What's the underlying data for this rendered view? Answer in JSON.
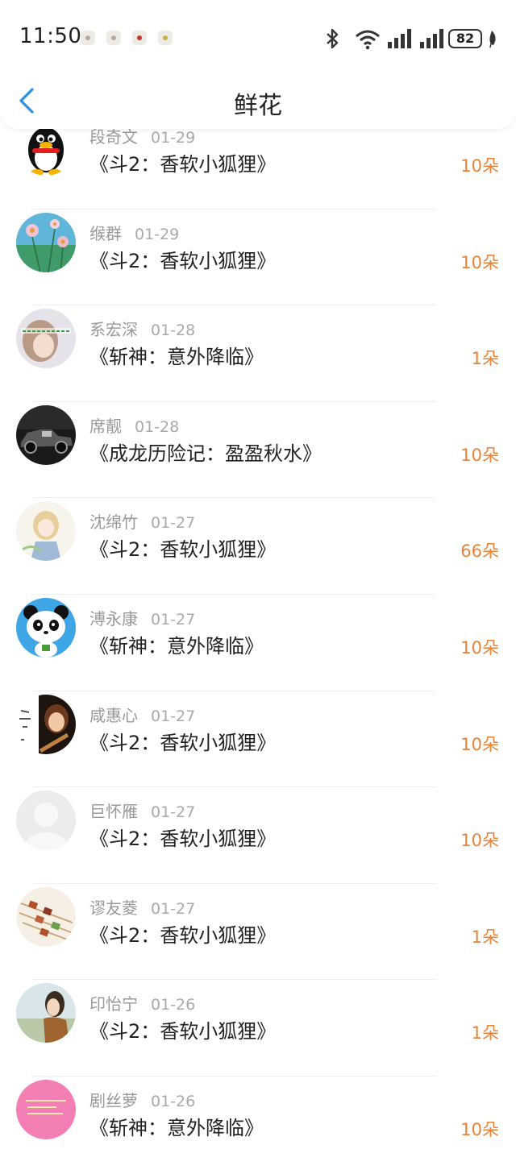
{
  "status_bar": {
    "time": "11:50",
    "battery": "82",
    "icons": [
      "notification-icon",
      "notification-icon",
      "notification-icon",
      "notification-icon",
      "bluetooth-icon",
      "wifi-icon",
      "signal-icon",
      "signal-icon",
      "battery-icon",
      "leaf-icon"
    ]
  },
  "nav": {
    "title": "鲜花",
    "back_icon": "chevron-left-icon"
  },
  "colors": {
    "accent": "#2b8fe6",
    "amount": "#e8833a",
    "meta": "#999999"
  },
  "flowers": [
    {
      "name": "段奇文",
      "date": "01-29",
      "work": "《斗2：香软小狐狸》",
      "amount": "10朵",
      "avatar": "penguin-avatar"
    },
    {
      "name": "缑群",
      "date": "01-29",
      "work": "《斗2：香软小狐狸》",
      "amount": "10朵",
      "avatar": "flowers-sky-avatar"
    },
    {
      "name": "系宏深",
      "date": "01-28",
      "work": "《斩神：意外降临》",
      "amount": "1朵",
      "avatar": "girl-text-avatar"
    },
    {
      "name": "席靓",
      "date": "01-28",
      "work": "《成龙历险记：盈盈秋水》",
      "amount": "10朵",
      "avatar": "vintage-car-avatar"
    },
    {
      "name": "沈绵竹",
      "date": "01-27",
      "work": "《斗2：香软小狐狸》",
      "amount": "66朵",
      "avatar": "anime-girl-avatar"
    },
    {
      "name": "溥永康",
      "date": "01-27",
      "work": "《斩神：意外降临》",
      "amount": "10朵",
      "avatar": "panda-avatar"
    },
    {
      "name": "咸惠心",
      "date": "01-27",
      "work": "《斗2：香软小狐狸》",
      "amount": "10朵",
      "avatar": "girl-guitar-avatar"
    },
    {
      "name": "巨怀雁",
      "date": "01-27",
      "work": "《斗2：香软小狐狸》",
      "amount": "10朵",
      "avatar": "default-user-avatar"
    },
    {
      "name": "谬友菱",
      "date": "01-27",
      "work": "《斗2：香软小狐狸》",
      "amount": "1朵",
      "avatar": "skewers-avatar"
    },
    {
      "name": "印怡宁",
      "date": "01-26",
      "work": "《斗2：香软小狐狸》",
      "amount": "1朵",
      "avatar": "woman-scarf-avatar"
    },
    {
      "name": "剧丝萝",
      "date": "01-26",
      "work": "《斩神：意外降临》",
      "amount": "10朵",
      "avatar": "pink-text-avatar"
    }
  ]
}
